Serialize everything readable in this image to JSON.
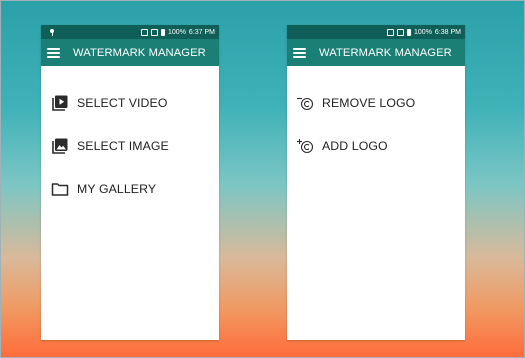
{
  "app": {
    "title": "WATERMARK MANAGER"
  },
  "screens": [
    {
      "status": {
        "battery": "100%",
        "time": "6:37 PM"
      },
      "menu": [
        {
          "label": "SELECT VIDEO",
          "icon": "video-icon"
        },
        {
          "label": "SELECT IMAGE",
          "icon": "image-icon"
        },
        {
          "label": "MY GALLERY",
          "icon": "folder-icon"
        }
      ]
    },
    {
      "status": {
        "battery": "100%",
        "time": "6:38 PM"
      },
      "menu": [
        {
          "label": "REMOVE LOGO",
          "icon": "remove-logo-icon"
        },
        {
          "label": "ADD LOGO",
          "icon": "add-logo-icon"
        }
      ]
    }
  ],
  "colors": {
    "status_bar": "#0f5e57",
    "app_bar": "#1a7f74",
    "menu_text": "#222222",
    "icon_dark": "#2b2b2b"
  }
}
